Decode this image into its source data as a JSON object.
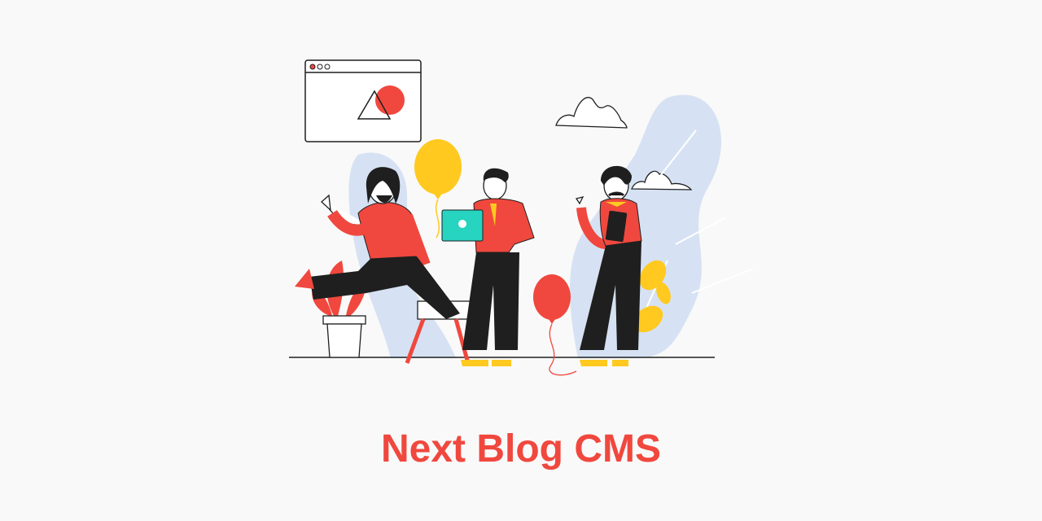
{
  "title": "Next Blog CMS",
  "colors": {
    "background": "#f9f9f9",
    "title": "#f0483e",
    "accent_red": "#f0483e",
    "balloon_yellow": "#ffc91f",
    "laptop_teal": "#26d4c0",
    "backdrop_blue": "#d6e2f3",
    "outline": "#1f1f1f"
  },
  "illustration": {
    "icons": [
      "browser-window-icon",
      "cloud-icon",
      "balloon-icon",
      "laptop-icon",
      "potted-plant-icon",
      "chair-icon",
      "people-group"
    ]
  }
}
